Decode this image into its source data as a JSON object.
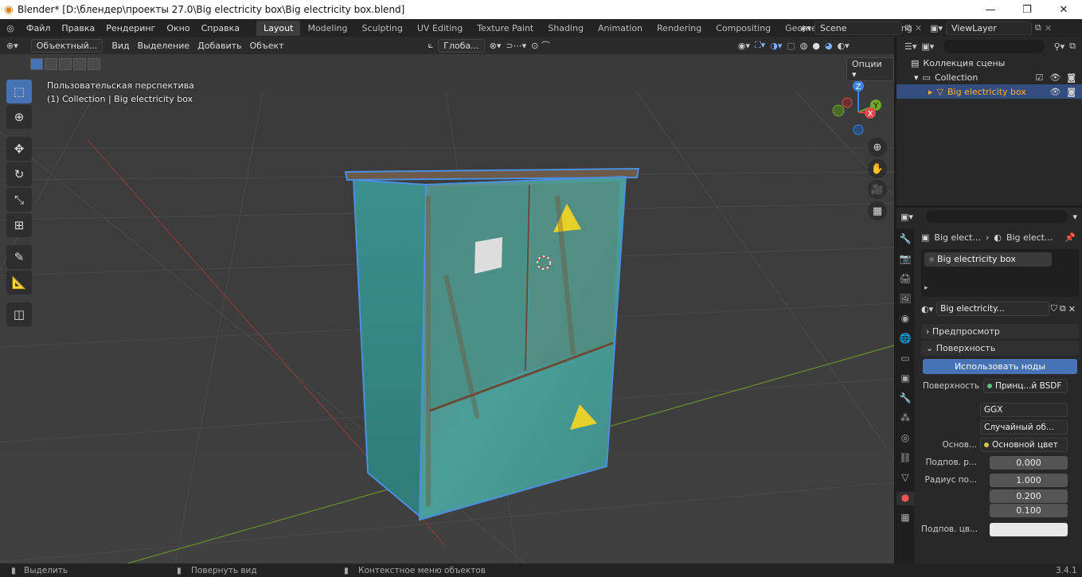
{
  "window": {
    "title": "Blender* [D:\\блендер\\проекты 27.0\\Big electricity box\\Big electricity box.blend]",
    "minimize": "—",
    "maximize": "❐",
    "close": "✕"
  },
  "menu": [
    "Файл",
    "Правка",
    "Рендеринг",
    "Окно",
    "Справка"
  ],
  "workspaces": [
    "Layout",
    "Modeling",
    "Sculpting",
    "UV Editing",
    "Texture Paint",
    "Shading",
    "Animation",
    "Rendering",
    "Compositing",
    "Geometry Nodes",
    "Scripting"
  ],
  "scene": "Scene",
  "view_layer": "ViewLayer",
  "viewport": {
    "mode": "Объектный...",
    "menus": [
      "Вид",
      "Выделение",
      "Добавить",
      "Объект"
    ],
    "transform_orientation": "Глоба...",
    "options_label": "Опции",
    "overlay_line1": "Пользовательская перспектива",
    "overlay_line2": "(1) Collection | Big electricity box",
    "gizmo_labels": [
      "Z",
      "Y",
      "X"
    ]
  },
  "outliner": {
    "items": [
      {
        "label": "Коллекция сцены"
      },
      {
        "label": "Collection"
      },
      {
        "label": "Big electricity box"
      }
    ]
  },
  "properties": {
    "breadcrumb_1": "Big elect...",
    "breadcrumb_2": "Big elect...",
    "material_slot": "Big electricity box",
    "material_name": "Big electricity...",
    "panel_preview": "Предпросмотр",
    "panel_surface": "Поверхность",
    "use_nodes_button": "Использовать ноды",
    "surface_label": "Поверхность",
    "surface_value": "Принц...й BSDF",
    "distribution": "GGX",
    "subsurface_method": "Случайный об...",
    "base_label": "Основ...",
    "base_value": "Основной цвет",
    "subsurface_label": "Подпов. р...",
    "subsurface_value": "0.000",
    "radius_label": "Радиус по...",
    "radius_values": [
      "1.000",
      "0.200",
      "0.100"
    ],
    "subsurface_color_label": "Подпов. цв..."
  },
  "status": {
    "left": "Выделить",
    "middle": "Повернуть вид",
    "right": "Контекстное меню объектов",
    "version": "3.4.1"
  }
}
